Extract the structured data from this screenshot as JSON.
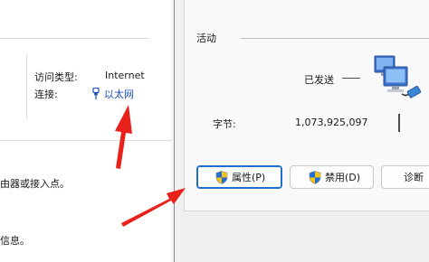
{
  "background_window": {
    "access_type_label": "访问类型:",
    "access_type_value": "Internet",
    "connection_label": "连接:",
    "connection_value": "以太网",
    "line1_fragment": "由器或接入点。",
    "line2_fragment": "信息。"
  },
  "dialog": {
    "activity_title": "活动",
    "sent_label": "已发送",
    "bytes_label": "字节:",
    "bytes_sent": "1,073,925,097",
    "buttons": {
      "properties": "属性(P)",
      "disable": "禁用(D)",
      "diagnose": "诊断"
    }
  },
  "icons": [
    "ethernet-connection-icon",
    "network-computers-icon",
    "uac-shield-icon",
    "red-arrow"
  ],
  "colors": {
    "link": "#1a4fb8",
    "primary_border": "#1a6fd1",
    "arrow": "#e8221b"
  }
}
